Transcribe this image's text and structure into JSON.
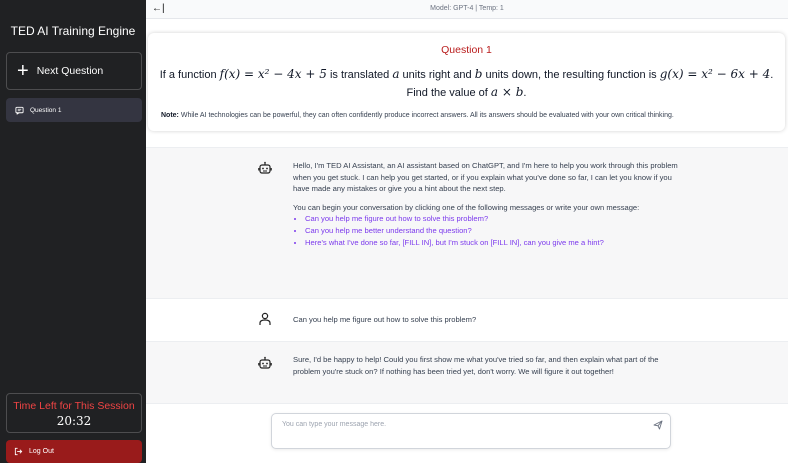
{
  "sidebar": {
    "title": "TED AI Training Engine",
    "next_question_label": "Next Question",
    "next_question_icon": "plus-icon",
    "items": [
      {
        "label": "Question 1",
        "icon": "chat-icon"
      }
    ],
    "timer_label": "Time Left for This Session",
    "timer_value": "20:32",
    "logout_label": "Log Out",
    "logout_icon": "logout-icon"
  },
  "topbar": {
    "collapse_glyph": "←|",
    "model_info": "Model: GPT-4 | Temp: 1"
  },
  "question": {
    "title": "Question 1",
    "line1_prefix": "If a function ",
    "f_expr": "f(x) = x² − 4x + 5",
    "line1_mid1": " is translated ",
    "a_var": "a",
    "line1_mid2": " units right and ",
    "b_var": "b",
    "line1_mid3": " units down, the resulting function is ",
    "g_expr": "g(x) = x² − 6x + 4",
    "line1_suffix": ".",
    "line2_prefix": "Find the value of ",
    "product_expr": "a × b",
    "line2_suffix": ".",
    "note_label": "Note:",
    "note_text": " While AI technologies can be powerful, they can often confidently produce incorrect answers. All its answers should be evaluated with your own critical thinking."
  },
  "messages": [
    {
      "role": "assistant",
      "avatar_icon": "robot-icon",
      "paragraphs": [
        "Hello, I'm TED AI Assistant, an AI assistant based on ChatGPT, and I'm here to help you work through this problem when you get stuck. I can help you get started, or if you explain what you've done so far, I can let you know if you have made any mistakes or give you a hint about the next step.",
        "You can begin your conversation by clicking one of the following messages or write your own message:"
      ],
      "suggestions": [
        "Can you help me figure out how to solve this problem?",
        "Can you help me better understand the question?",
        "Here's what I've done so far, [FILL IN], but I'm stuck on [FILL IN], can you give me a hint?"
      ]
    },
    {
      "role": "user",
      "avatar_icon": "user-icon",
      "text": "Can you help me figure out how to solve this problem?"
    },
    {
      "role": "assistant",
      "avatar_icon": "robot-icon",
      "text": "Sure, I'd be happy to help! Could you first show me what you've tried so far, and then explain what part of the problem you're stuck on? If nothing has been tried yet, don't worry. We will figure it out together!"
    }
  ],
  "input": {
    "placeholder": "You can type your message here.",
    "value": "",
    "send_icon": "send-icon"
  },
  "colors": {
    "sidebar_bg": "#202123",
    "accent_red": "#b91c1c",
    "logout_bg": "#991b1b",
    "suggestion_purple": "#7c3aed",
    "timer_label": "#ef4444"
  }
}
